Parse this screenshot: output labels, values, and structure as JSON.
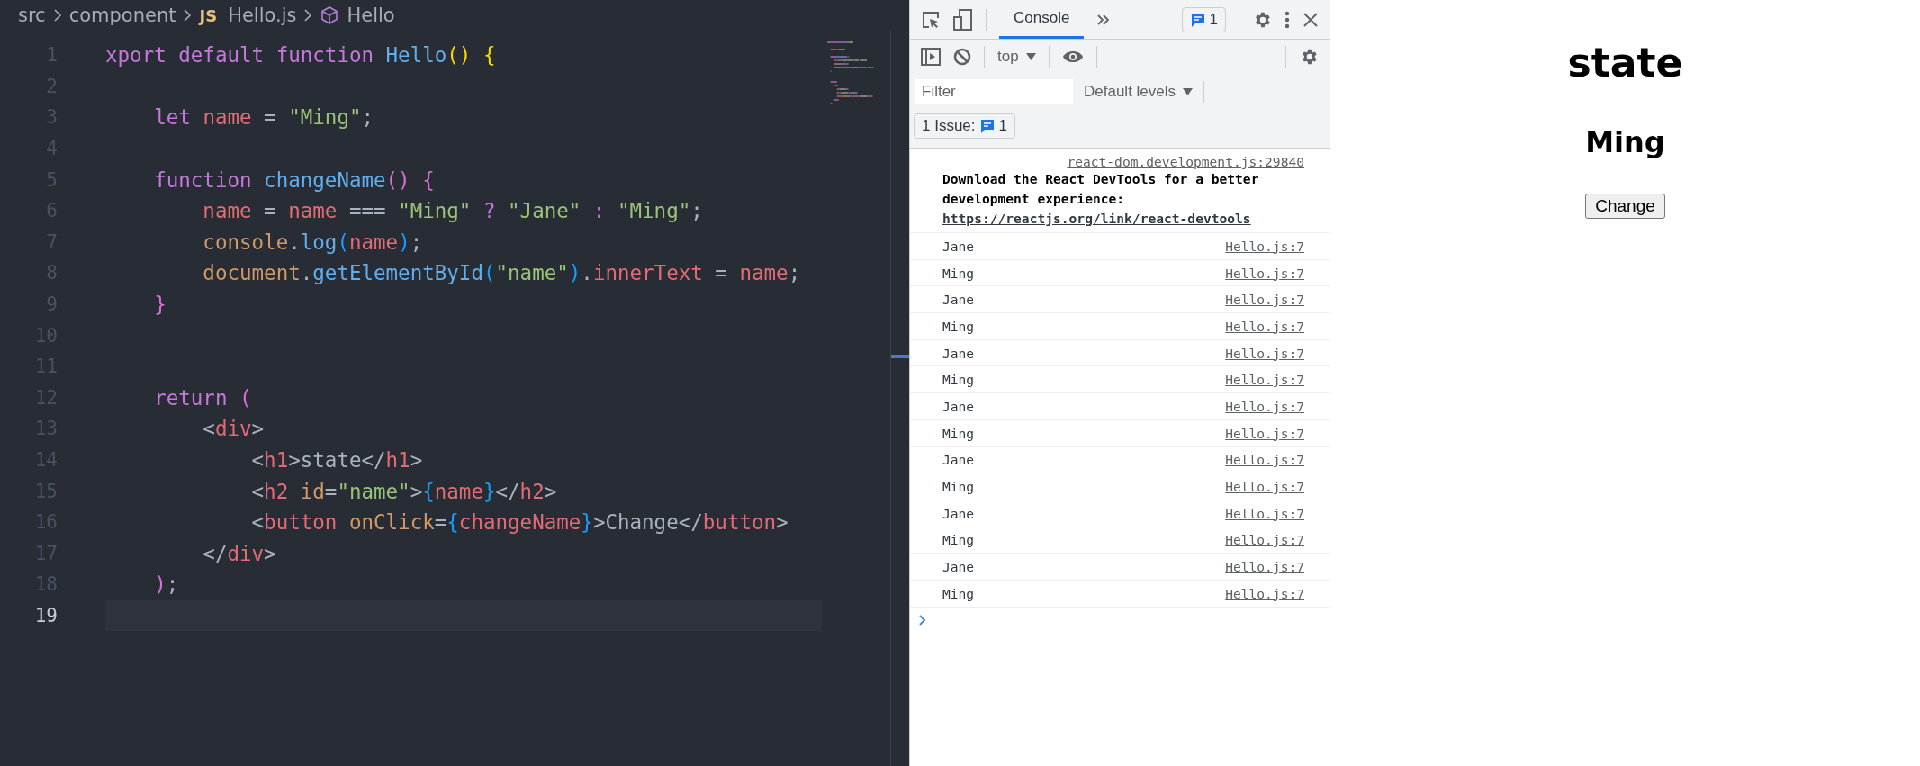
{
  "editor": {
    "breadcrumbs": [
      {
        "text": "src",
        "kind": "folder"
      },
      {
        "text": "component",
        "kind": "folder"
      },
      {
        "text": "Hello.js",
        "kind": "file",
        "badge": "JS"
      },
      {
        "text": "Hello",
        "kind": "symbol"
      }
    ],
    "lines": [
      {
        "number": "1",
        "current": false,
        "tokens": [
          {
            "text": "xport default function ",
            "kind": "kw"
          },
          {
            "text": "Hello",
            "kind": "fn"
          },
          {
            "text": "()",
            "kind": "b1"
          },
          {
            "text": " {",
            "kind": "b1"
          }
        ]
      },
      {
        "number": "2",
        "current": false
      },
      {
        "number": "3",
        "current": false,
        "tokens": [
          {
            "text": "    let ",
            "kind": "kw"
          },
          {
            "text": "name",
            "kind": "var"
          },
          {
            "text": " = ",
            "kind": "txt"
          },
          {
            "text": "\"Ming\"",
            "kind": "str"
          },
          {
            "text": ";",
            "kind": "txt"
          }
        ]
      },
      {
        "number": "4",
        "current": false
      },
      {
        "number": "5",
        "current": false,
        "tokens": [
          {
            "text": "    function ",
            "kind": "kw"
          },
          {
            "text": "changeName",
            "kind": "fn"
          },
          {
            "text": "()",
            "kind": "b2"
          },
          {
            "text": " {",
            "kind": "b2"
          }
        ]
      },
      {
        "number": "6",
        "current": false,
        "tokens": [
          {
            "text": "        name",
            "kind": "var"
          },
          {
            "text": " = ",
            "kind": "txt"
          },
          {
            "text": "name",
            "kind": "var"
          },
          {
            "text": " === ",
            "kind": "txt"
          },
          {
            "text": "\"Ming\"",
            "kind": "str"
          },
          {
            "text": " ? ",
            "kind": "kw"
          },
          {
            "text": "\"Jane\"",
            "kind": "str"
          },
          {
            "text": " : ",
            "kind": "kw"
          },
          {
            "text": "\"Ming\"",
            "kind": "str"
          },
          {
            "text": ";",
            "kind": "txt"
          }
        ]
      },
      {
        "number": "7",
        "current": false,
        "tokens": [
          {
            "text": "        console",
            "kind": "obj"
          },
          {
            "text": ".",
            "kind": "txt"
          },
          {
            "text": "log",
            "kind": "fn"
          },
          {
            "text": "(",
            "kind": "b3"
          },
          {
            "text": "name",
            "kind": "var"
          },
          {
            "text": ")",
            "kind": "b3"
          },
          {
            "text": ";",
            "kind": "txt"
          }
        ]
      },
      {
        "number": "8",
        "current": false,
        "tokens": [
          {
            "text": "        document",
            "kind": "obj"
          },
          {
            "text": ".",
            "kind": "txt"
          },
          {
            "text": "getElementById",
            "kind": "fn"
          },
          {
            "text": "(",
            "kind": "b3"
          },
          {
            "text": "\"name\"",
            "kind": "str"
          },
          {
            "text": ")",
            "kind": "b3"
          },
          {
            "text": ".",
            "kind": "txt"
          },
          {
            "text": "innerText",
            "kind": "var"
          },
          {
            "text": " = ",
            "kind": "txt"
          },
          {
            "text": "name",
            "kind": "var"
          },
          {
            "text": ";",
            "kind": "txt"
          }
        ]
      },
      {
        "number": "9",
        "current": false,
        "tokens": [
          {
            "text": "    }",
            "kind": "b2"
          }
        ]
      },
      {
        "number": "10",
        "current": false
      },
      {
        "number": "11",
        "current": false
      },
      {
        "number": "12",
        "current": false,
        "tokens": [
          {
            "text": "    return ",
            "kind": "kw"
          },
          {
            "text": "(",
            "kind": "b2"
          }
        ]
      },
      {
        "number": "13",
        "current": false,
        "tokens": [
          {
            "text": "        <",
            "kind": "txt"
          },
          {
            "text": "div",
            "kind": "tag"
          },
          {
            "text": ">",
            "kind": "txt"
          }
        ]
      },
      {
        "number": "14",
        "current": false,
        "tokens": [
          {
            "text": "            <",
            "kind": "txt"
          },
          {
            "text": "h1",
            "kind": "tag"
          },
          {
            "text": ">state</",
            "kind": "txt"
          },
          {
            "text": "h1",
            "kind": "tag"
          },
          {
            "text": ">",
            "kind": "txt"
          }
        ]
      },
      {
        "number": "15",
        "current": false,
        "tokens": [
          {
            "text": "            <",
            "kind": "txt"
          },
          {
            "text": "h2",
            "kind": "tag"
          },
          {
            "text": " id",
            "kind": "attr"
          },
          {
            "text": "=",
            "kind": "txt"
          },
          {
            "text": "\"name\"",
            "kind": "str"
          },
          {
            "text": ">",
            "kind": "txt"
          },
          {
            "text": "{",
            "kind": "b3"
          },
          {
            "text": "name",
            "kind": "var"
          },
          {
            "text": "}",
            "kind": "b3"
          },
          {
            "text": "</",
            "kind": "txt"
          },
          {
            "text": "h2",
            "kind": "tag"
          },
          {
            "text": ">",
            "kind": "txt"
          }
        ]
      },
      {
        "number": "16",
        "current": false,
        "tokens": [
          {
            "text": "            <",
            "kind": "txt"
          },
          {
            "text": "button",
            "kind": "tag"
          },
          {
            "text": " onClick",
            "kind": "attr"
          },
          {
            "text": "=",
            "kind": "txt"
          },
          {
            "text": "{",
            "kind": "b3"
          },
          {
            "text": "changeName",
            "kind": "var"
          },
          {
            "text": "}",
            "kind": "b3"
          },
          {
            "text": ">Change</",
            "kind": "txt"
          },
          {
            "text": "button",
            "kind": "tag"
          },
          {
            "text": ">",
            "kind": "txt"
          }
        ]
      },
      {
        "number": "17",
        "current": false,
        "tokens": [
          {
            "text": "        </",
            "kind": "txt"
          },
          {
            "text": "div",
            "kind": "tag"
          },
          {
            "text": ">",
            "kind": "txt"
          }
        ]
      },
      {
        "number": "18",
        "current": false,
        "tokens": [
          {
            "text": "    )",
            "kind": "b2"
          },
          {
            "text": ";",
            "kind": "txt"
          }
        ]
      },
      {
        "number": "19",
        "current": true
      }
    ]
  },
  "devtools": {
    "tabs": [
      {
        "label": "Console",
        "selected": true
      }
    ],
    "issue_badge": "1",
    "context": "top",
    "filter": {
      "placeholder": "Filter"
    },
    "levels": "Default levels",
    "issues": {
      "label": "1 Issue:",
      "count": "1"
    },
    "messages": [
      {
        "kind": "info",
        "source": "react-dom.development.js:29840",
        "text": "Download the React DevTools for a better development experience: ",
        "link": "https://reactjs.org/link/react-devtools"
      },
      {
        "kind": "log",
        "text": "Jane",
        "source": "Hello.js:7"
      },
      {
        "kind": "log",
        "text": "Ming",
        "source": "Hello.js:7"
      },
      {
        "kind": "log",
        "text": "Jane",
        "source": "Hello.js:7"
      },
      {
        "kind": "log",
        "text": "Ming",
        "source": "Hello.js:7"
      },
      {
        "kind": "log",
        "text": "Jane",
        "source": "Hello.js:7"
      },
      {
        "kind": "log",
        "text": "Ming",
        "source": "Hello.js:7"
      },
      {
        "kind": "log",
        "text": "Jane",
        "source": "Hello.js:7"
      },
      {
        "kind": "log",
        "text": "Ming",
        "source": "Hello.js:7"
      },
      {
        "kind": "log",
        "text": "Jane",
        "source": "Hello.js:7"
      },
      {
        "kind": "log",
        "text": "Ming",
        "source": "Hello.js:7"
      },
      {
        "kind": "log",
        "text": "Jane",
        "source": "Hello.js:7"
      },
      {
        "kind": "log",
        "text": "Ming",
        "source": "Hello.js:7"
      },
      {
        "kind": "log",
        "text": "Jane",
        "source": "Hello.js:7"
      },
      {
        "kind": "log",
        "text": "Ming",
        "source": "Hello.js:7"
      }
    ]
  },
  "page": {
    "heading": "state",
    "subheading": "Ming",
    "button": "Change"
  }
}
